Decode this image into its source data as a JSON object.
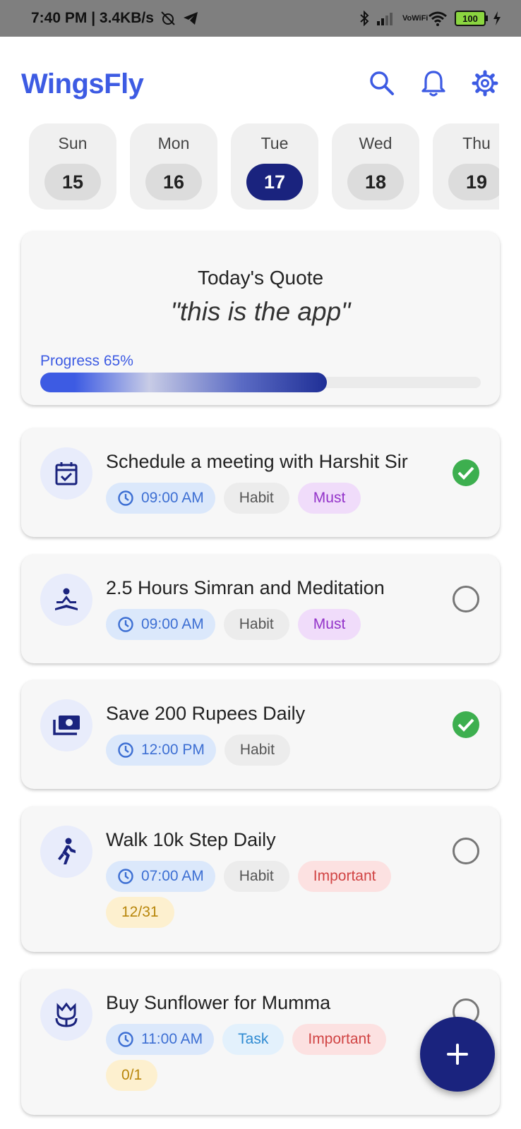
{
  "status_bar": {
    "time_speed": "7:40 PM | 3.4KB/s",
    "network": "VoWiFi",
    "battery": "100"
  },
  "app": {
    "title": "WingsFly",
    "accent_color": "#3d5be3",
    "primary_dark": "#1a237e",
    "actions": [
      "search-icon",
      "bell-icon",
      "gear-icon"
    ]
  },
  "days": [
    {
      "name": "Sun",
      "num": "15",
      "selected": false
    },
    {
      "name": "Mon",
      "num": "16",
      "selected": false
    },
    {
      "name": "Tue",
      "num": "17",
      "selected": true
    },
    {
      "name": "Wed",
      "num": "18",
      "selected": false
    },
    {
      "name": "Thu",
      "num": "19",
      "selected": false
    }
  ],
  "quote": {
    "title": "Today's Quote",
    "text": "\"this is the app\"",
    "progress_label": "Progress 65%",
    "progress_fraction": 0.65
  },
  "tasks": [
    {
      "title": "Schedule a meeting with Harshit Sir",
      "icon": "calendar-check-icon",
      "time": "09:00 AM",
      "type": "Habit",
      "priority": "Must",
      "done": true
    },
    {
      "title": "2.5 Hours Simran and Meditation",
      "icon": "meditation-icon",
      "time": "09:00 AM",
      "type": "Habit",
      "priority": "Must",
      "done": false
    },
    {
      "title": "Save 200 Rupees Daily",
      "icon": "money-icon",
      "time": "12:00 PM",
      "type": "Habit",
      "done": true
    },
    {
      "title": "Walk 10k Step Daily",
      "icon": "walking-icon",
      "time": "07:00 AM",
      "type": "Habit",
      "priority": "Important",
      "count": "12/31",
      "done": false
    },
    {
      "title": "Buy Sunflower for Mumma",
      "icon": "flower-icon",
      "time": "11:00 AM",
      "type": "Task",
      "priority": "Important",
      "count": "0/1",
      "done": false
    }
  ],
  "fab": {
    "label": "+"
  }
}
